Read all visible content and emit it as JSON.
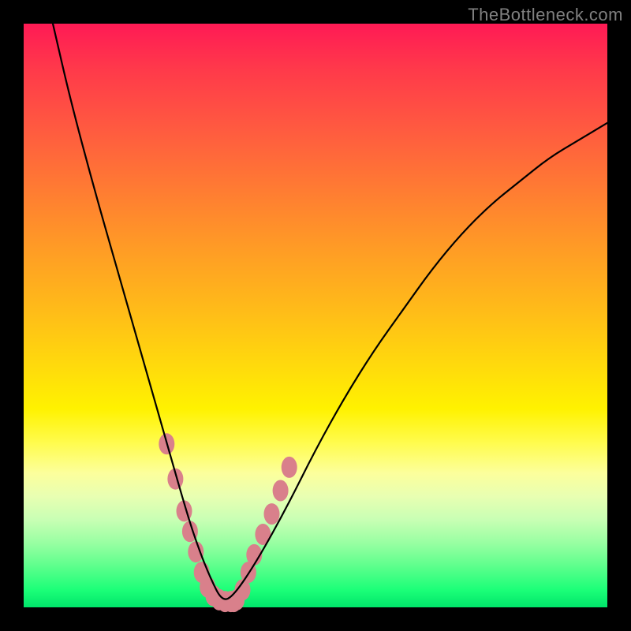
{
  "watermark": "TheBottleneck.com",
  "chart_data": {
    "type": "line",
    "title": "",
    "xlabel": "",
    "ylabel": "",
    "xlim": [
      0,
      100
    ],
    "ylim": [
      0,
      100
    ],
    "grid": false,
    "legend": false,
    "series": [
      {
        "name": "bottleneck-curve",
        "color": "#000000",
        "x": [
          5,
          8,
          12,
          16,
          20,
          24,
          28,
          30,
          32,
          34,
          36,
          40,
          45,
          50,
          55,
          60,
          65,
          70,
          75,
          80,
          85,
          90,
          95,
          100
        ],
        "y": [
          100,
          87,
          72,
          58,
          44,
          30,
          16,
          10,
          5,
          1,
          2,
          8,
          17,
          27,
          36,
          44,
          51,
          58,
          64,
          69,
          73,
          77,
          80,
          83
        ]
      },
      {
        "name": "highlight-dots",
        "type": "scatter",
        "color": "#d9808b",
        "radius": 10,
        "x": [
          24.5,
          26.0,
          27.5,
          28.5,
          29.5,
          30.5,
          31.5,
          32.5,
          33.5,
          34.5,
          35.5,
          36.0,
          36.5,
          37.5,
          38.5,
          39.5,
          41.0,
          42.5,
          44.0,
          45.5
        ],
        "y": [
          28.0,
          22.0,
          16.5,
          13.0,
          9.5,
          6.0,
          3.5,
          2.0,
          1.3,
          1.0,
          1.0,
          1.0,
          1.3,
          3.0,
          6.0,
          9.0,
          12.5,
          16.0,
          20.0,
          24.0
        ]
      }
    ]
  }
}
